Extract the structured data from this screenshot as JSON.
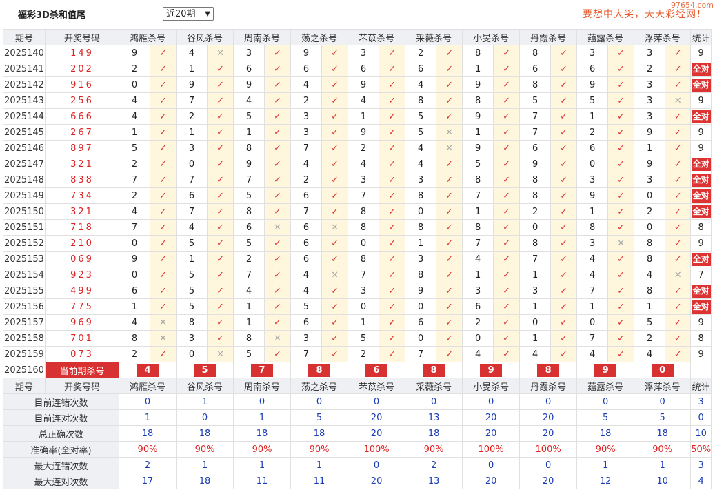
{
  "app": {
    "title": "福彩3D杀和值尾",
    "period_select": "近20期",
    "slogan": "要想中大奖，天天彩经网！",
    "watermark": "97654.com"
  },
  "colors": {
    "accent_red": "#d83131",
    "stat_blue": "#1a3db4",
    "hit_bg": "#fff7dd"
  },
  "headers": {
    "period": "期号",
    "draw": "开奖号码",
    "experts": [
      "鸿雁杀号",
      "谷风杀号",
      "周南杀号",
      "荡之杀号",
      "芣苡杀号",
      "采薇杀号",
      "小旻杀号",
      "丹霞杀号",
      "蕴露杀号",
      "浮萍杀号"
    ],
    "stat": "统计"
  },
  "rows": [
    {
      "period": "2025140",
      "draw": "149",
      "picks": [
        "9",
        "4",
        "3",
        "9",
        "3",
        "2",
        "8",
        "8",
        "3",
        "3"
      ],
      "hits": [
        1,
        0,
        1,
        1,
        1,
        1,
        1,
        1,
        1,
        1
      ],
      "stat": "9"
    },
    {
      "period": "2025141",
      "draw": "202",
      "picks": [
        "2",
        "1",
        "6",
        "6",
        "6",
        "6",
        "1",
        "6",
        "6",
        "2"
      ],
      "hits": [
        1,
        1,
        1,
        1,
        1,
        1,
        1,
        1,
        1,
        1
      ],
      "stat": "全对"
    },
    {
      "period": "2025142",
      "draw": "916",
      "picks": [
        "0",
        "9",
        "9",
        "4",
        "9",
        "4",
        "9",
        "8",
        "9",
        "3"
      ],
      "hits": [
        1,
        1,
        1,
        1,
        1,
        1,
        1,
        1,
        1,
        1
      ],
      "stat": "全对"
    },
    {
      "period": "2025143",
      "draw": "256",
      "picks": [
        "4",
        "7",
        "4",
        "2",
        "4",
        "8",
        "8",
        "5",
        "5",
        "3"
      ],
      "hits": [
        1,
        1,
        1,
        1,
        1,
        1,
        1,
        1,
        1,
        0
      ],
      "stat": "9"
    },
    {
      "period": "2025144",
      "draw": "666",
      "picks": [
        "4",
        "2",
        "5",
        "3",
        "1",
        "5",
        "9",
        "7",
        "1",
        "3"
      ],
      "hits": [
        1,
        1,
        1,
        1,
        1,
        1,
        1,
        1,
        1,
        1
      ],
      "stat": "全对"
    },
    {
      "period": "2025145",
      "draw": "267",
      "picks": [
        "1",
        "1",
        "1",
        "3",
        "9",
        "5",
        "1",
        "7",
        "2",
        "9"
      ],
      "hits": [
        1,
        1,
        1,
        1,
        1,
        0,
        1,
        1,
        1,
        1
      ],
      "stat": "9"
    },
    {
      "period": "2025146",
      "draw": "897",
      "picks": [
        "5",
        "3",
        "8",
        "7",
        "2",
        "4",
        "9",
        "6",
        "6",
        "1"
      ],
      "hits": [
        1,
        1,
        1,
        1,
        1,
        0,
        1,
        1,
        1,
        1
      ],
      "stat": "9"
    },
    {
      "period": "2025147",
      "draw": "321",
      "picks": [
        "2",
        "0",
        "9",
        "4",
        "4",
        "4",
        "5",
        "9",
        "0",
        "9"
      ],
      "hits": [
        1,
        1,
        1,
        1,
        1,
        1,
        1,
        1,
        1,
        1
      ],
      "stat": "全对"
    },
    {
      "period": "2025148",
      "draw": "838",
      "picks": [
        "7",
        "7",
        "7",
        "2",
        "3",
        "3",
        "8",
        "8",
        "3",
        "3"
      ],
      "hits": [
        1,
        1,
        1,
        1,
        1,
        1,
        1,
        1,
        1,
        1
      ],
      "stat": "全对"
    },
    {
      "period": "2025149",
      "draw": "734",
      "picks": [
        "2",
        "6",
        "5",
        "6",
        "7",
        "8",
        "7",
        "8",
        "9",
        "0"
      ],
      "hits": [
        1,
        1,
        1,
        1,
        1,
        1,
        1,
        1,
        1,
        1
      ],
      "stat": "全对"
    },
    {
      "period": "2025150",
      "draw": "321",
      "picks": [
        "4",
        "7",
        "8",
        "7",
        "8",
        "0",
        "1",
        "2",
        "1",
        "2"
      ],
      "hits": [
        1,
        1,
        1,
        1,
        1,
        1,
        1,
        1,
        1,
        1
      ],
      "stat": "全对"
    },
    {
      "period": "2025151",
      "draw": "718",
      "picks": [
        "7",
        "4",
        "6",
        "6",
        "8",
        "8",
        "8",
        "0",
        "8",
        "0"
      ],
      "hits": [
        1,
        1,
        0,
        0,
        1,
        1,
        1,
        1,
        1,
        1
      ],
      "stat": "8"
    },
    {
      "period": "2025152",
      "draw": "210",
      "picks": [
        "0",
        "5",
        "5",
        "6",
        "0",
        "1",
        "7",
        "8",
        "3",
        "8"
      ],
      "hits": [
        1,
        1,
        1,
        1,
        1,
        1,
        1,
        1,
        0,
        1
      ],
      "stat": "9"
    },
    {
      "period": "2025153",
      "draw": "069",
      "picks": [
        "9",
        "1",
        "2",
        "6",
        "8",
        "3",
        "4",
        "7",
        "4",
        "8"
      ],
      "hits": [
        1,
        1,
        1,
        1,
        1,
        1,
        1,
        1,
        1,
        1
      ],
      "stat": "全对"
    },
    {
      "period": "2025154",
      "draw": "923",
      "picks": [
        "0",
        "5",
        "7",
        "4",
        "7",
        "8",
        "1",
        "1",
        "4",
        "4"
      ],
      "hits": [
        1,
        1,
        1,
        0,
        1,
        1,
        1,
        1,
        1,
        0
      ],
      "stat": "7"
    },
    {
      "period": "2025155",
      "draw": "499",
      "picks": [
        "6",
        "5",
        "4",
        "4",
        "3",
        "9",
        "3",
        "3",
        "7",
        "8"
      ],
      "hits": [
        1,
        1,
        1,
        1,
        1,
        1,
        1,
        1,
        1,
        1
      ],
      "stat": "全对"
    },
    {
      "period": "2025156",
      "draw": "775",
      "picks": [
        "1",
        "5",
        "1",
        "5",
        "0",
        "0",
        "6",
        "1",
        "1",
        "1"
      ],
      "hits": [
        1,
        1,
        1,
        1,
        1,
        1,
        1,
        1,
        1,
        1
      ],
      "stat": "全对"
    },
    {
      "period": "2025157",
      "draw": "969",
      "picks": [
        "4",
        "8",
        "1",
        "6",
        "1",
        "6",
        "2",
        "0",
        "0",
        "5"
      ],
      "hits": [
        0,
        1,
        1,
        1,
        1,
        1,
        1,
        1,
        1,
        1
      ],
      "stat": "9"
    },
    {
      "period": "2025158",
      "draw": "701",
      "picks": [
        "8",
        "3",
        "8",
        "3",
        "5",
        "0",
        "0",
        "1",
        "7",
        "2"
      ],
      "hits": [
        0,
        1,
        0,
        1,
        1,
        1,
        1,
        1,
        1,
        1
      ],
      "stat": "8"
    },
    {
      "period": "2025159",
      "draw": "073",
      "picks": [
        "2",
        "0",
        "5",
        "7",
        "2",
        "7",
        "4",
        "4",
        "4",
        "4"
      ],
      "hits": [
        1,
        0,
        1,
        1,
        1,
        1,
        1,
        1,
        1,
        1
      ],
      "stat": "9"
    }
  ],
  "current": {
    "period": "2025160",
    "label": "当前期杀号",
    "picks": [
      "4",
      "5",
      "7",
      "8",
      "6",
      "8",
      "9",
      "8",
      "9",
      "0"
    ]
  },
  "stats": [
    {
      "label": "目前连错次数",
      "color": "blue",
      "values": [
        "0",
        "1",
        "0",
        "0",
        "0",
        "0",
        "0",
        "0",
        "0",
        "0"
      ],
      "total": "3"
    },
    {
      "label": "目前连对次数",
      "color": "blue",
      "values": [
        "1",
        "0",
        "1",
        "5",
        "20",
        "13",
        "20",
        "20",
        "5",
        "5"
      ],
      "total": "0"
    },
    {
      "label": "总正确次数",
      "color": "blue",
      "values": [
        "18",
        "18",
        "18",
        "18",
        "20",
        "18",
        "20",
        "20",
        "18",
        "18"
      ],
      "total": "10"
    },
    {
      "label": "准确率(全对率)",
      "color": "red",
      "values": [
        "90%",
        "90%",
        "90%",
        "90%",
        "100%",
        "90%",
        "100%",
        "100%",
        "90%",
        "90%"
      ],
      "total": "50%"
    },
    {
      "label": "最大连错次数",
      "color": "blue",
      "values": [
        "2",
        "1",
        "1",
        "1",
        "0",
        "2",
        "0",
        "0",
        "1",
        "1"
      ],
      "total": "3"
    },
    {
      "label": "最大连对次数",
      "color": "blue",
      "values": [
        "17",
        "18",
        "11",
        "11",
        "20",
        "13",
        "20",
        "20",
        "12",
        "10"
      ],
      "total": "4"
    }
  ],
  "icons": {
    "hit": "check-icon",
    "miss": "cross-icon"
  },
  "glyphs": {
    "hit": "✓",
    "miss": "✕"
  }
}
